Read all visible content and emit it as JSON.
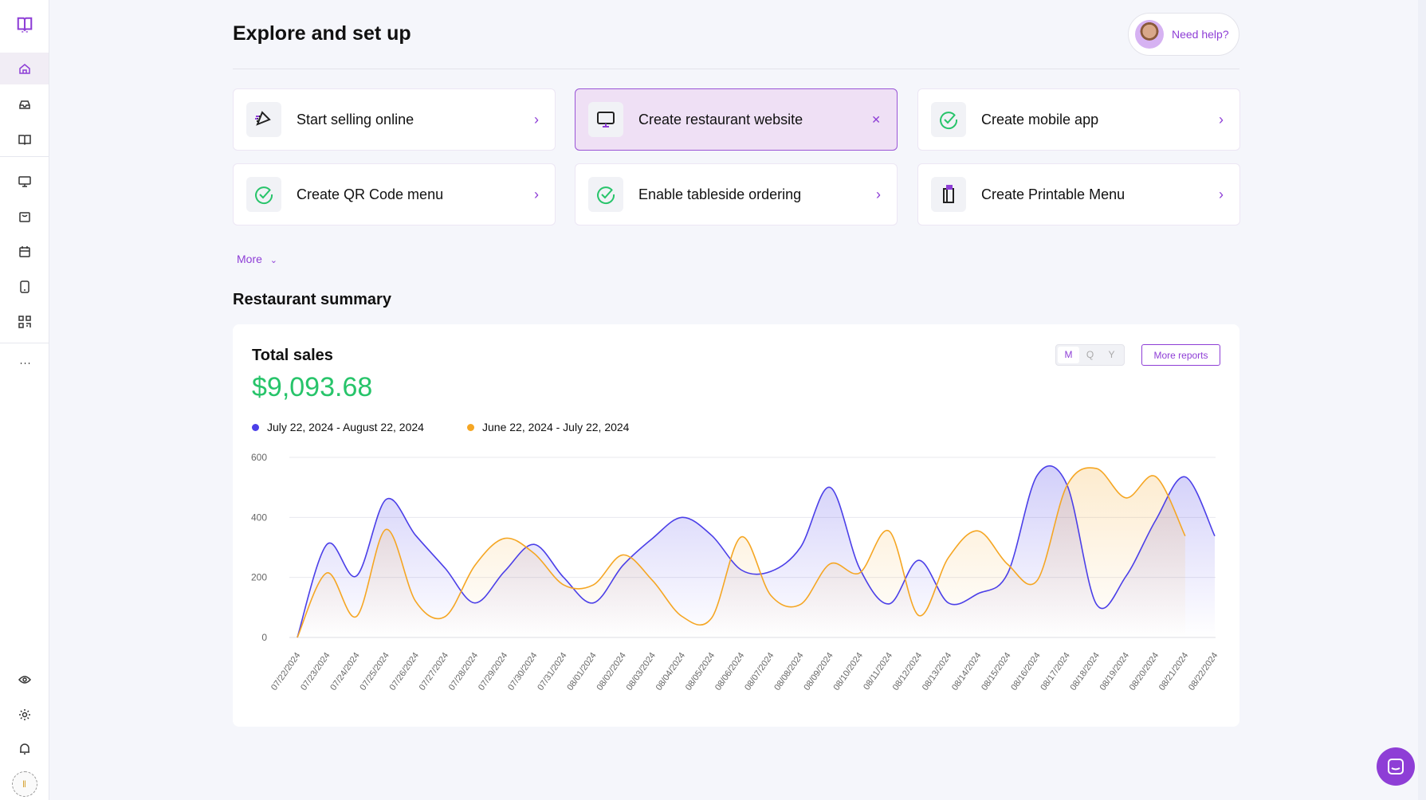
{
  "sidebar": {
    "items": [
      {
        "icon": "logo-icon"
      },
      {
        "icon": "home-icon",
        "active": true
      },
      {
        "icon": "inbox-icon"
      },
      {
        "icon": "book-icon"
      },
      {
        "icon": "monitor-icon"
      },
      {
        "icon": "bag-icon"
      },
      {
        "icon": "calendar-icon"
      },
      {
        "icon": "phone-icon"
      },
      {
        "icon": "qr-code-icon"
      },
      {
        "icon": "more-icon"
      },
      {
        "icon": "eye-icon"
      },
      {
        "icon": "gear-icon"
      },
      {
        "icon": "bell-icon"
      },
      {
        "icon": "restaurant-avatar"
      }
    ]
  },
  "header": {
    "title": "Explore and set up",
    "help_label": "Need help?"
  },
  "cards": [
    {
      "label": "Start selling online",
      "icon": "pizza-icon",
      "action": "chevron"
    },
    {
      "label": "Create restaurant website",
      "icon": "monitor-icon",
      "action": "close",
      "selected": true
    },
    {
      "label": "Create mobile app",
      "icon": "check-circle-icon",
      "action": "chevron"
    },
    {
      "label": "Create QR Code menu",
      "icon": "check-circle-icon",
      "action": "chevron"
    },
    {
      "label": "Enable tableside ordering",
      "icon": "check-circle-icon",
      "action": "chevron"
    },
    {
      "label": "Create Printable Menu",
      "icon": "printable-menu-icon",
      "action": "chevron"
    }
  ],
  "more_label": "More",
  "summary": {
    "title": "Restaurant summary",
    "card_title": "Total sales",
    "total": "$9,093.68",
    "toggle": [
      "M",
      "Q",
      "Y"
    ],
    "toggle_selected": "M",
    "more_reports": "More reports"
  },
  "colors": {
    "accent": "#8e3ed6",
    "current": "#4b3fe8",
    "previous": "#f5a623",
    "positive": "#27c46a"
  },
  "chart_data": {
    "type": "area",
    "x": [
      "07/22/2024",
      "07/23/2024",
      "07/24/2024",
      "07/25/2024",
      "07/26/2024",
      "07/27/2024",
      "07/28/2024",
      "07/29/2024",
      "07/30/2024",
      "07/31/2024",
      "08/01/2024",
      "08/02/2024",
      "08/03/2024",
      "08/04/2024",
      "08/05/2024",
      "08/06/2024",
      "08/07/2024",
      "08/08/2024",
      "08/09/2024",
      "08/10/2024",
      "08/11/2024",
      "08/12/2024",
      "08/13/2024",
      "08/14/2024",
      "08/15/2024",
      "08/16/2024",
      "08/17/2024",
      "08/18/2024",
      "08/19/2024",
      "08/20/2024",
      "08/21/2024",
      "08/22/2024"
    ],
    "series": [
      {
        "name": "July 22, 2024 - August 22, 2024",
        "color": "#4b3fe8",
        "values": [
          0,
          310,
          205,
          460,
          340,
          230,
          115,
          220,
          310,
          200,
          115,
          240,
          330,
          400,
          340,
          225,
          220,
          300,
          500,
          230,
          112,
          257,
          115,
          146,
          213,
          540,
          510,
          111,
          204,
          390,
          535,
          338
        ]
      },
      {
        "name": "June 22, 2024 - July 22, 2024",
        "color": "#f5a623",
        "values": [
          0,
          215,
          70,
          360,
          120,
          70,
          240,
          330,
          280,
          175,
          175,
          275,
          190,
          70,
          65,
          335,
          140,
          110,
          245,
          215,
          354,
          73,
          266,
          355,
          244,
          190,
          505,
          563,
          465,
          536,
          338
        ]
      }
    ],
    "yticks": [
      0,
      200,
      400,
      600
    ],
    "ylim": [
      0,
      600
    ],
    "grid": true,
    "legend": "top-left"
  }
}
